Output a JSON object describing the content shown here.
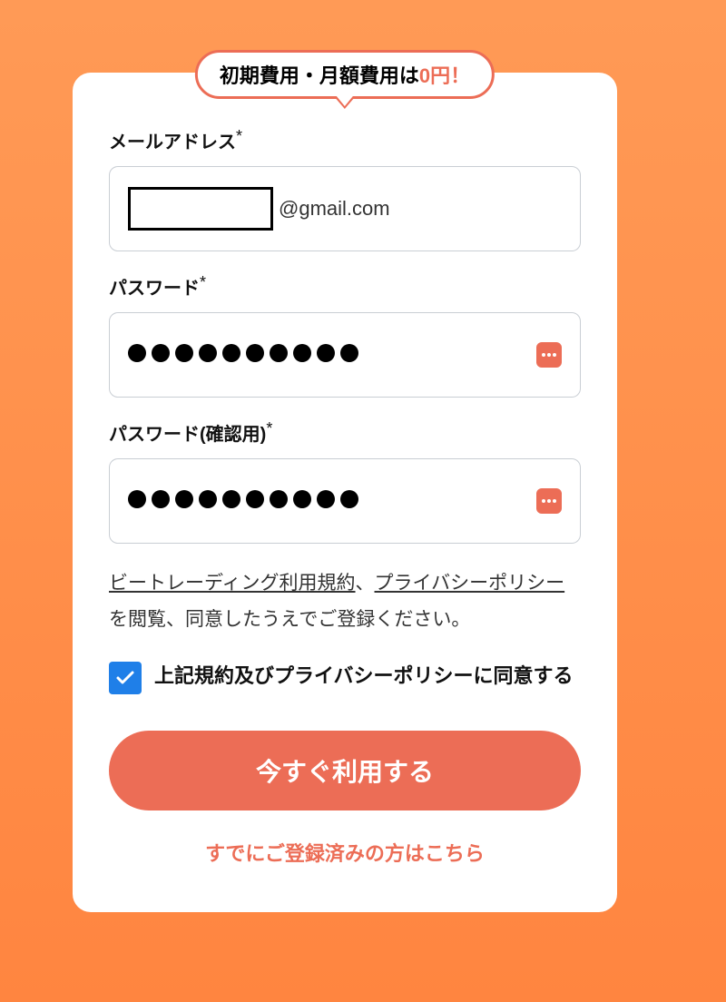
{
  "badge": {
    "prefix": "初期費用・月額費用は",
    "accent": "0円",
    "suffix": "！"
  },
  "email": {
    "label": "メールアドレス",
    "req": "*",
    "value": "",
    "suffix": "@gmail.com"
  },
  "password": {
    "label": "パスワード",
    "req": "*",
    "masked_length": 10
  },
  "password_confirm": {
    "label": "パスワード(確認用)",
    "req": "*",
    "masked_length": 10
  },
  "terms": {
    "link1": "ビートレーディング利用規約",
    "sep": "、",
    "link2": "プライバシーポリシー",
    "tail": "を閲覧、同意したうえでご登録ください。"
  },
  "consent": {
    "checked": true,
    "label": "上記規約及びプライバシーポリシーに同意する"
  },
  "submit": {
    "label": "今すぐ利用する"
  },
  "already": {
    "label": "すでにご登録済みの方はこちら"
  }
}
